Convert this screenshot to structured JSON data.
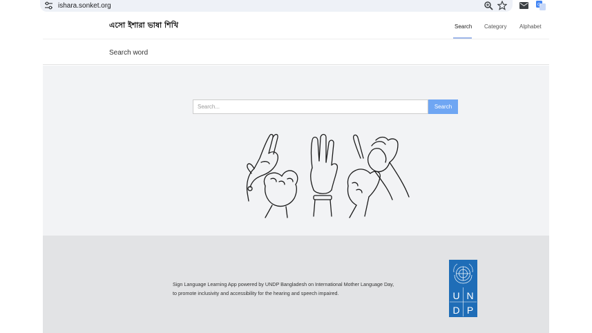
{
  "browser": {
    "url": "ishara.sonket.org"
  },
  "site": {
    "brand": "এসো ইশারা ভাষা শিখি",
    "nav": {
      "search": "Search",
      "category": "Category",
      "alphabet": "Alphabet"
    },
    "subheader_title": "Search word"
  },
  "search": {
    "placeholder": "Search...",
    "button_label": "Search"
  },
  "footer": {
    "text_line1": "Sign Language Learning App powered by UNDP Bangladesh on International Mother Language Day,",
    "text_line2": "to promote inclusivity and accessibility for the hearing and speech impaired.",
    "logo_letters": [
      "U",
      "N",
      "D",
      "P"
    ]
  },
  "colors": {
    "accent": "#6fa6f3",
    "undp_blue": "#1f6db7",
    "hero_bg": "#f2f3f5",
    "footer_bg": "#e2e3e5"
  }
}
